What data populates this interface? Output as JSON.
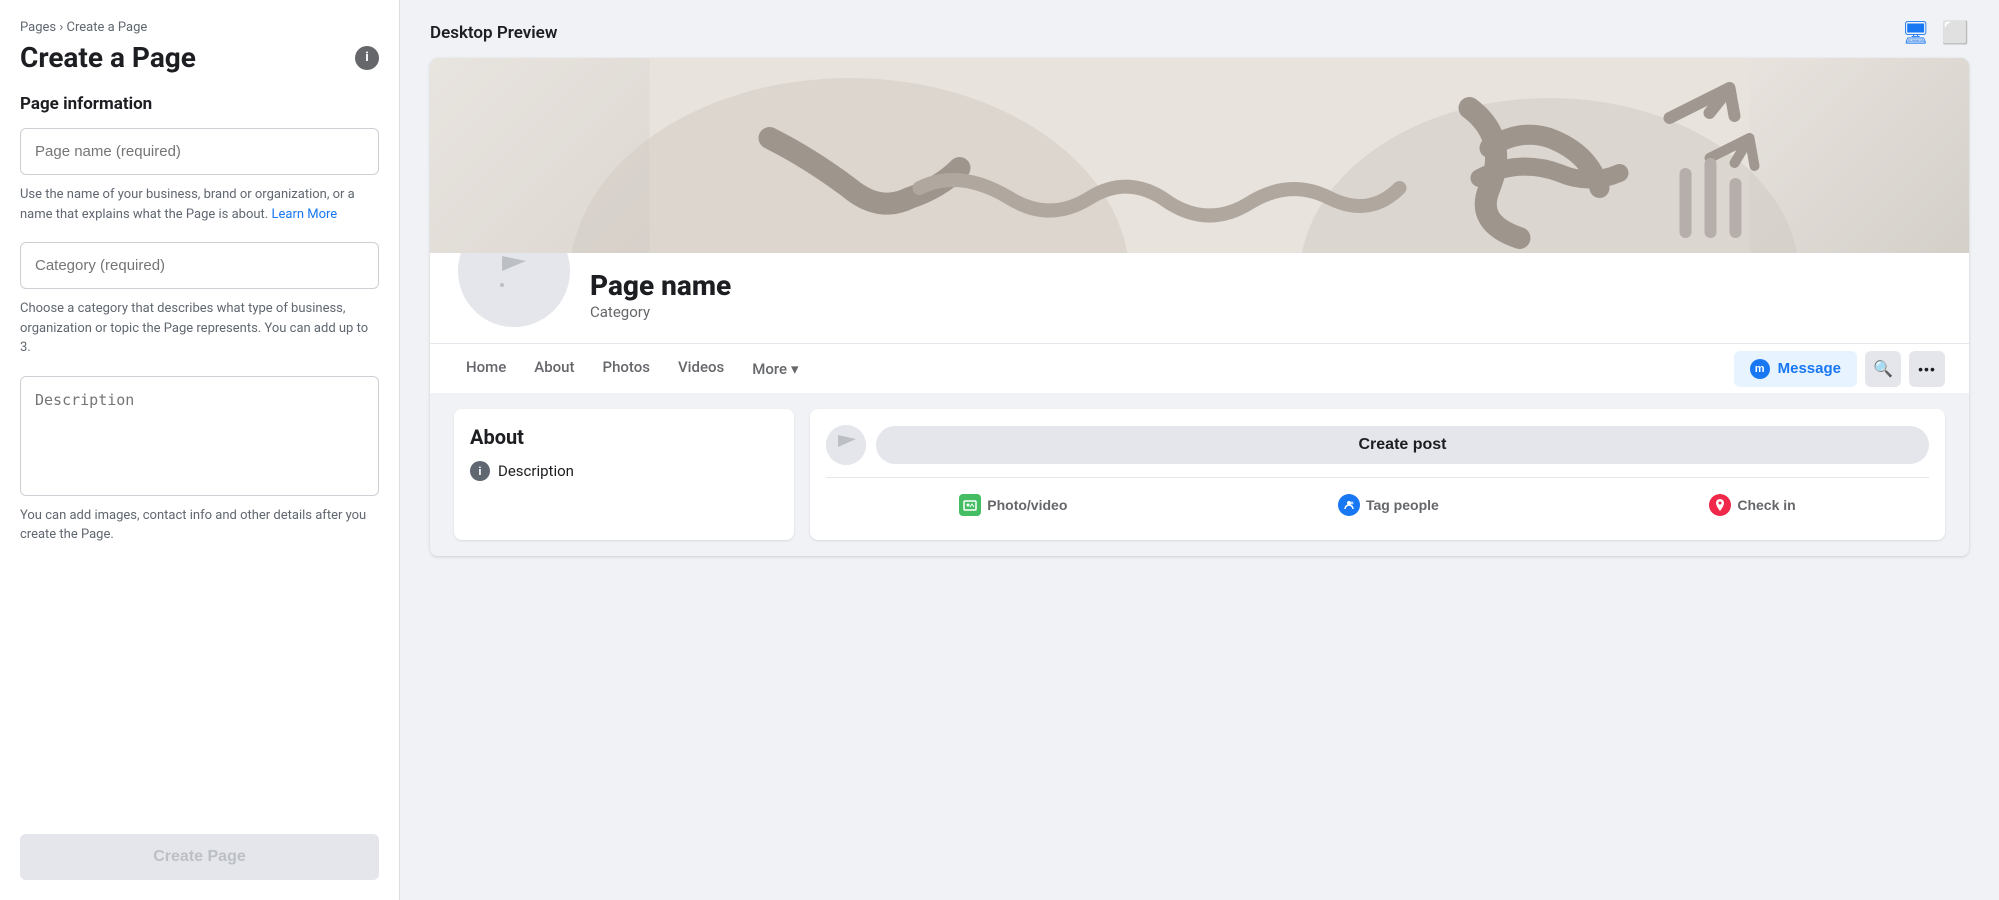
{
  "breadcrumb": {
    "pages_label": "Pages",
    "separator": "›",
    "current": "Create a Page"
  },
  "left_panel": {
    "title": "Create a Page",
    "info_icon_label": "i",
    "section_title": "Page information",
    "page_name_placeholder": "Page name (required)",
    "page_name_helper": "Use the name of your business, brand or organization, or a name that explains what the Page is about.",
    "learn_more_link": "Learn More",
    "category_placeholder": "Category (required)",
    "category_helper": "Choose a category that describes what type of business, organization or topic the Page represents. You can add up to 3.",
    "description_placeholder": "Description",
    "description_helper": "You can add images, contact info and other details after you create the Page.",
    "create_button_label": "Create Page"
  },
  "preview": {
    "header_label": "Desktop Preview",
    "page_name": "Page name",
    "page_category": "Category",
    "nav_items": [
      {
        "label": "Home"
      },
      {
        "label": "About"
      },
      {
        "label": "Photos"
      },
      {
        "label": "Videos"
      },
      {
        "label": "More"
      }
    ],
    "more_dropdown_arrow": "▾",
    "message_button": "Message",
    "about_section": {
      "title": "About",
      "description_label": "Description"
    },
    "create_post": {
      "button_label": "Create post",
      "actions": [
        {
          "label": "Photo/video",
          "icon": "photo"
        },
        {
          "label": "Tag people",
          "icon": "tag"
        },
        {
          "label": "Check in",
          "icon": "checkin"
        }
      ]
    }
  },
  "icons": {
    "info": "i",
    "messenger": "m",
    "search": "🔍",
    "more_dots": "•••",
    "desktop": "🖥",
    "tablet": "📱",
    "flag": "⚑",
    "chevron_down": "▾"
  }
}
